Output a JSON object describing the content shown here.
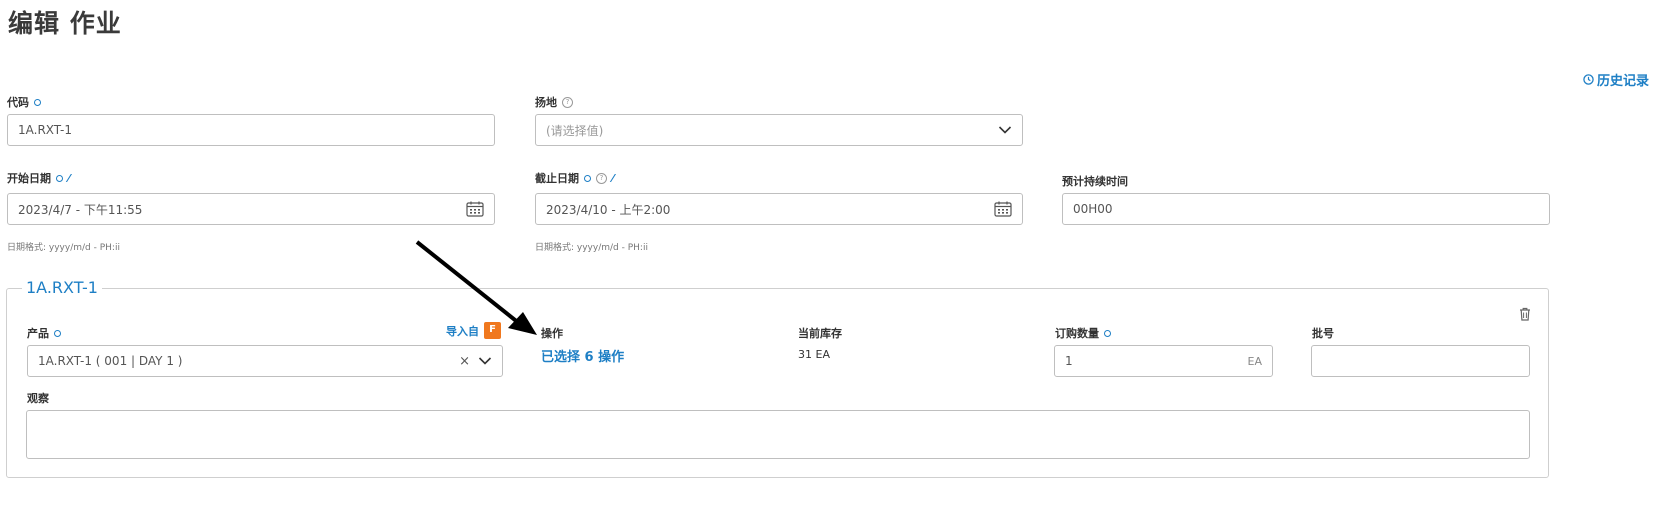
{
  "page": {
    "title": "编辑 作业",
    "history_link": "历史记录"
  },
  "form": {
    "code": {
      "label": "代码",
      "value": "1A.RXT-1"
    },
    "site": {
      "label": "扬地",
      "placeholder": "(请选择值)"
    },
    "start_date": {
      "label": "开始日期",
      "value": "2023/4/7 - 下午11:55",
      "hint": "日期格式: yyyy/m/d - PH:ii"
    },
    "end_date": {
      "label": "截止日期",
      "value": "2023/4/10 - 上午2:00",
      "hint": "日期格式: yyyy/m/d - PH:ii"
    },
    "duration": {
      "label": "预计持续时间",
      "value": "00H00"
    }
  },
  "item": {
    "legend": "1A.RXT-1",
    "product": {
      "label": "产品",
      "import_label": "导入自",
      "import_badge": "F",
      "value": "1A.RXT-1 ( 001 | DAY 1 )"
    },
    "operation": {
      "label": "操作",
      "value": "已选择 6 操作"
    },
    "stock": {
      "label": "当前库存",
      "value": "31 EA"
    },
    "order_qty": {
      "label": "订购数量",
      "value": "1",
      "unit": "EA"
    },
    "batch": {
      "label": "批号",
      "value": ""
    },
    "notes": {
      "label": "观察",
      "value": ""
    }
  },
  "colors": {
    "accent": "#1e7fc5",
    "badge": "#f0781e"
  },
  "icons": [
    "history-icon",
    "required-icon",
    "help-icon",
    "magic-wand-icon",
    "calendar-icon",
    "chevron-down-icon",
    "clear-icon",
    "trash-icon",
    "import-badge-icon"
  ]
}
